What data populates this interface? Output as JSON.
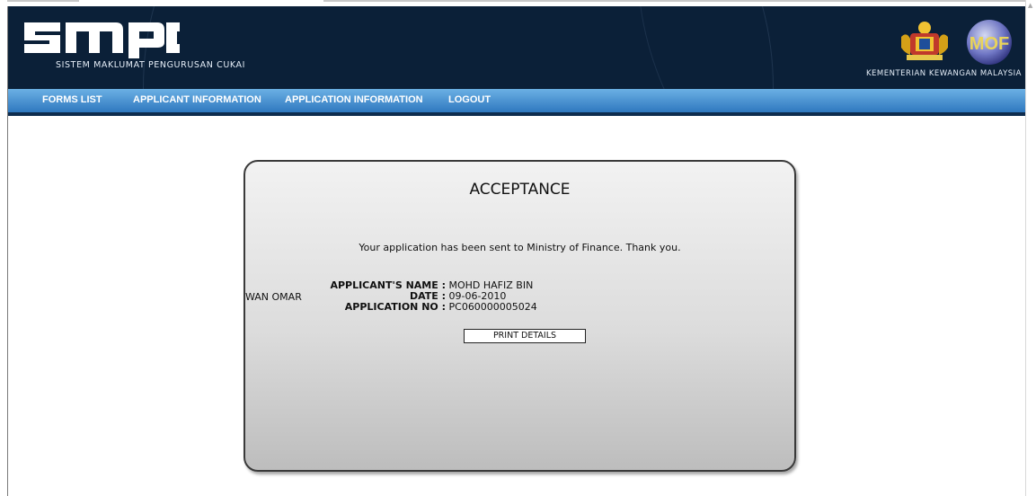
{
  "header": {
    "logo_text": "smpc",
    "system_name": "SISTEM MAKLUMAT PENGURUSAN CUKAI",
    "ministry_name": "KEMENTERIAN KEWANGAN MALAYSIA",
    "mof_logo_text": "MOF"
  },
  "nav": {
    "items": [
      {
        "label": "FORMS LIST"
      },
      {
        "label": "APPLICANT INFORMATION"
      },
      {
        "label": "APPLICATION INFORMATION"
      },
      {
        "label": "LOGOUT"
      }
    ]
  },
  "card": {
    "title": "ACCEPTANCE",
    "message": "Your application has been sent to Ministry of Finance. Thank you.",
    "fields": [
      {
        "label": "APPLICANT'S NAME :",
        "value": "MOHD HAFIZ BIN WAN OMAR"
      },
      {
        "label": "DATE :",
        "value": "09-06-2010"
      },
      {
        "label": "APPLICATION NO :",
        "value": "PC060000005024"
      }
    ],
    "print_label": "PRINT DETAILS"
  },
  "colors": {
    "header_bg": "#0b2038",
    "nav_bg": "#3b88cc",
    "card_bg": "#dcdcdc"
  }
}
